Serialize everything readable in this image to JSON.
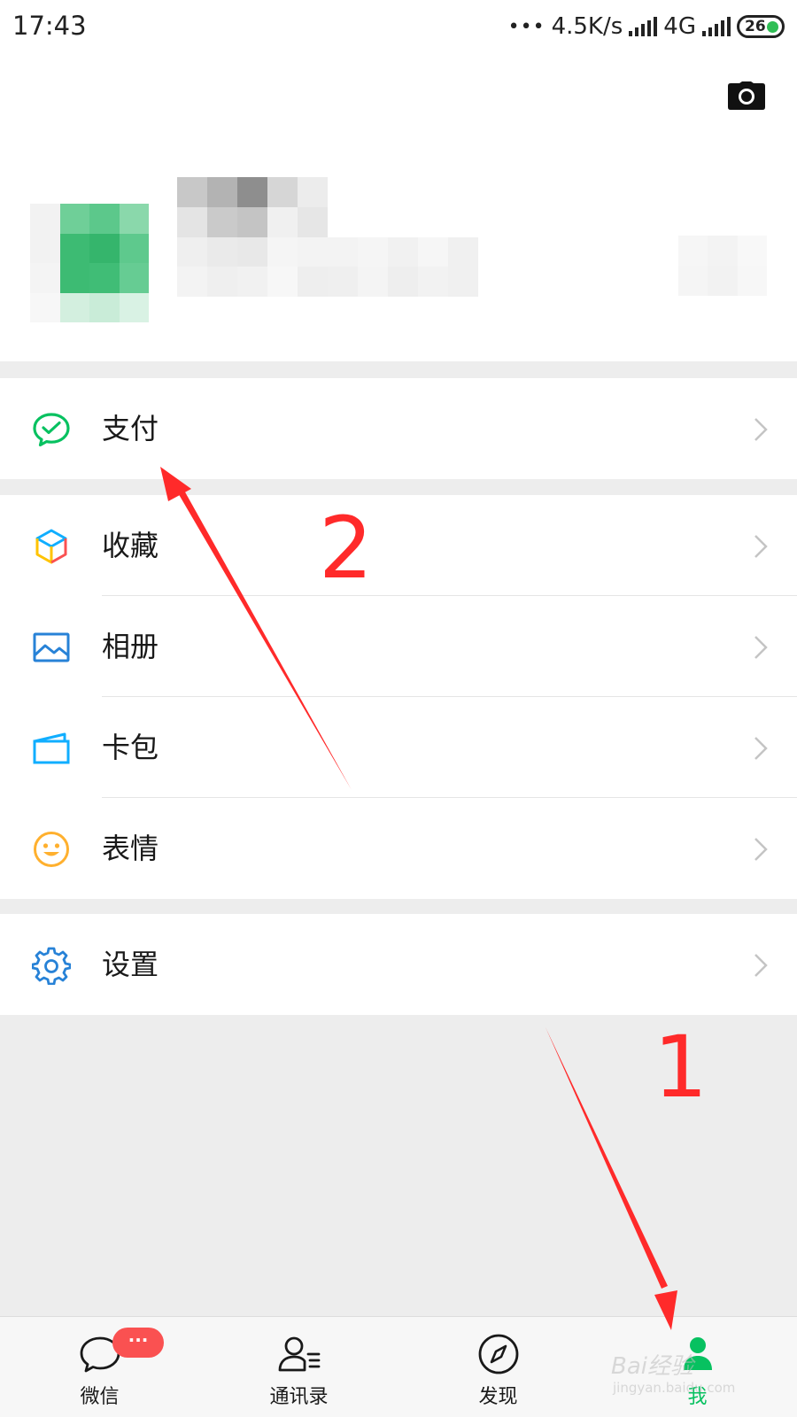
{
  "status_bar": {
    "time": "17:43",
    "dots": "•••",
    "speed": "4.5K/s",
    "network": "4G",
    "battery": "26"
  },
  "profile": {
    "camera_icon": "camera-icon"
  },
  "menu": {
    "pay": {
      "label": "支付",
      "icon": "wechat-pay-icon"
    },
    "favorites": {
      "label": "收藏",
      "icon": "cube-icon"
    },
    "album": {
      "label": "相册",
      "icon": "picture-icon"
    },
    "cards": {
      "label": "卡包",
      "icon": "card-wallet-icon"
    },
    "stickers": {
      "label": "表情",
      "icon": "smiley-icon"
    },
    "settings": {
      "label": "设置",
      "icon": "gear-icon"
    }
  },
  "tabbar": {
    "tabs": [
      {
        "label": "微信",
        "icon": "chat-bubble-icon",
        "badge": "···"
      },
      {
        "label": "通讯录",
        "icon": "contacts-icon"
      },
      {
        "label": "发现",
        "icon": "compass-icon"
      },
      {
        "label": "我",
        "icon": "person-icon",
        "active": true
      }
    ]
  },
  "annotations": {
    "step_1": "1",
    "step_2": "2"
  },
  "watermark": {
    "text": "Bai经验",
    "sub": "jingyan.baidu.com"
  },
  "colors": {
    "accent_green": "#07c160",
    "badge_red": "#fa5151",
    "annotation_red": "#ff2a2a",
    "page_bg": "#ededed"
  }
}
